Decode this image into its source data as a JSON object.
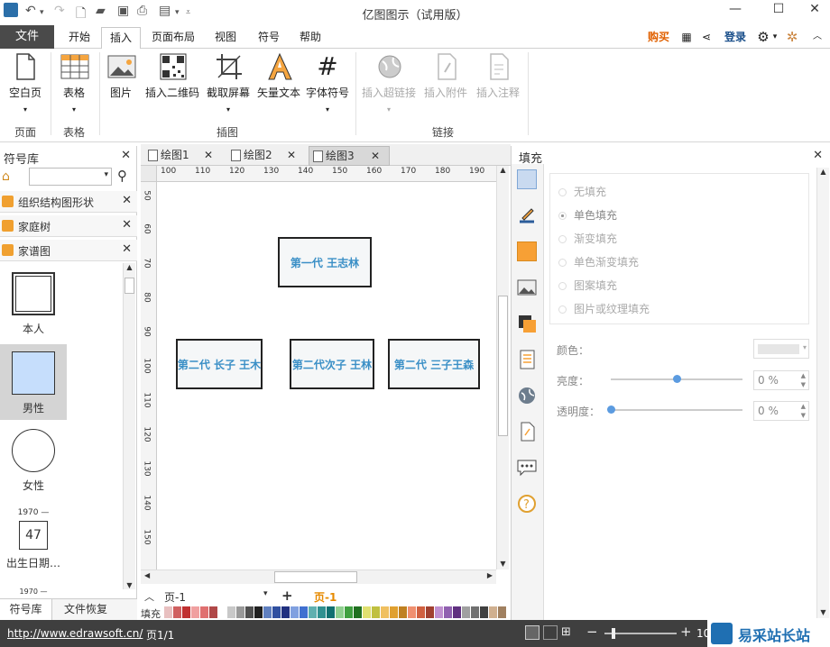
{
  "app": {
    "title": "亿图图示（试用版）"
  },
  "menu": {
    "file": "文件",
    "tabs": [
      "开始",
      "插入",
      "页面布局",
      "视图",
      "符号",
      "帮助"
    ],
    "active_tab": "插入",
    "buy": "购买",
    "login": "登录"
  },
  "ribbon": {
    "buttons": {
      "blank_page": "空白页",
      "table": "表格",
      "image": "图片",
      "qrcode": "插入二维码",
      "screenshot": "截取屏幕",
      "vector_text": "矢量文本",
      "font_symbol": "字体符号",
      "hyperlink": "插入超链接",
      "attachment": "插入附件",
      "annotation": "插入注释"
    },
    "groups": {
      "page": "页面",
      "table": "表格",
      "illustration": "插图",
      "link": "链接"
    }
  },
  "left_panel": {
    "title": "符号库",
    "libraries": [
      "组织结构图形状",
      "家庭树",
      "家谱图"
    ],
    "shapes": {
      "self": "本人",
      "male": "男性",
      "female": "女性",
      "birth_year": "1970 —",
      "age": "47",
      "birth_date": "出生日期…",
      "year2": "1970 —"
    },
    "bottom_tabs": [
      "符号库",
      "文件恢复"
    ]
  },
  "doc_tabs": [
    "绘图1",
    "绘图2",
    "绘图3"
  ],
  "active_doc": "绘图3",
  "ruler": {
    "h": [
      "100",
      "110",
      "120",
      "130",
      "140",
      "150",
      "160",
      "170",
      "180",
      "190"
    ],
    "v": [
      "50",
      "60",
      "70",
      "80",
      "90",
      "100",
      "110",
      "120",
      "130",
      "140",
      "150"
    ]
  },
  "diagram": {
    "gen1": "第一代 王志林",
    "gen2_a": "第二代 长子 王木",
    "gen2_b": "第二代次子 王林",
    "gen2_c": "第二代 三子王森"
  },
  "page_bar": {
    "page": "页-1",
    "page_tab": "页-1",
    "fill_label": "填充"
  },
  "fill_panel": {
    "title": "填充",
    "options": [
      "无填充",
      "单色填充",
      "渐变填充",
      "单色渐变填充",
      "图案填充",
      "图片或纹理填充"
    ],
    "color_label": "颜色：",
    "brightness_label": "亮度：",
    "brightness_value": "0 %",
    "brightness_level": 0.5,
    "transparency_label": "透明度：",
    "transparency_value": "0 %",
    "transparency_level": 0
  },
  "status": {
    "url": "http://www.edrawsoft.cn/",
    "page": "页1/1",
    "zoom": "10",
    "watermark": "易采站长站"
  },
  "colors": {
    "accent": "#3a8fc6",
    "orange": "#f7a035",
    "male_fill": "#c6defc"
  }
}
